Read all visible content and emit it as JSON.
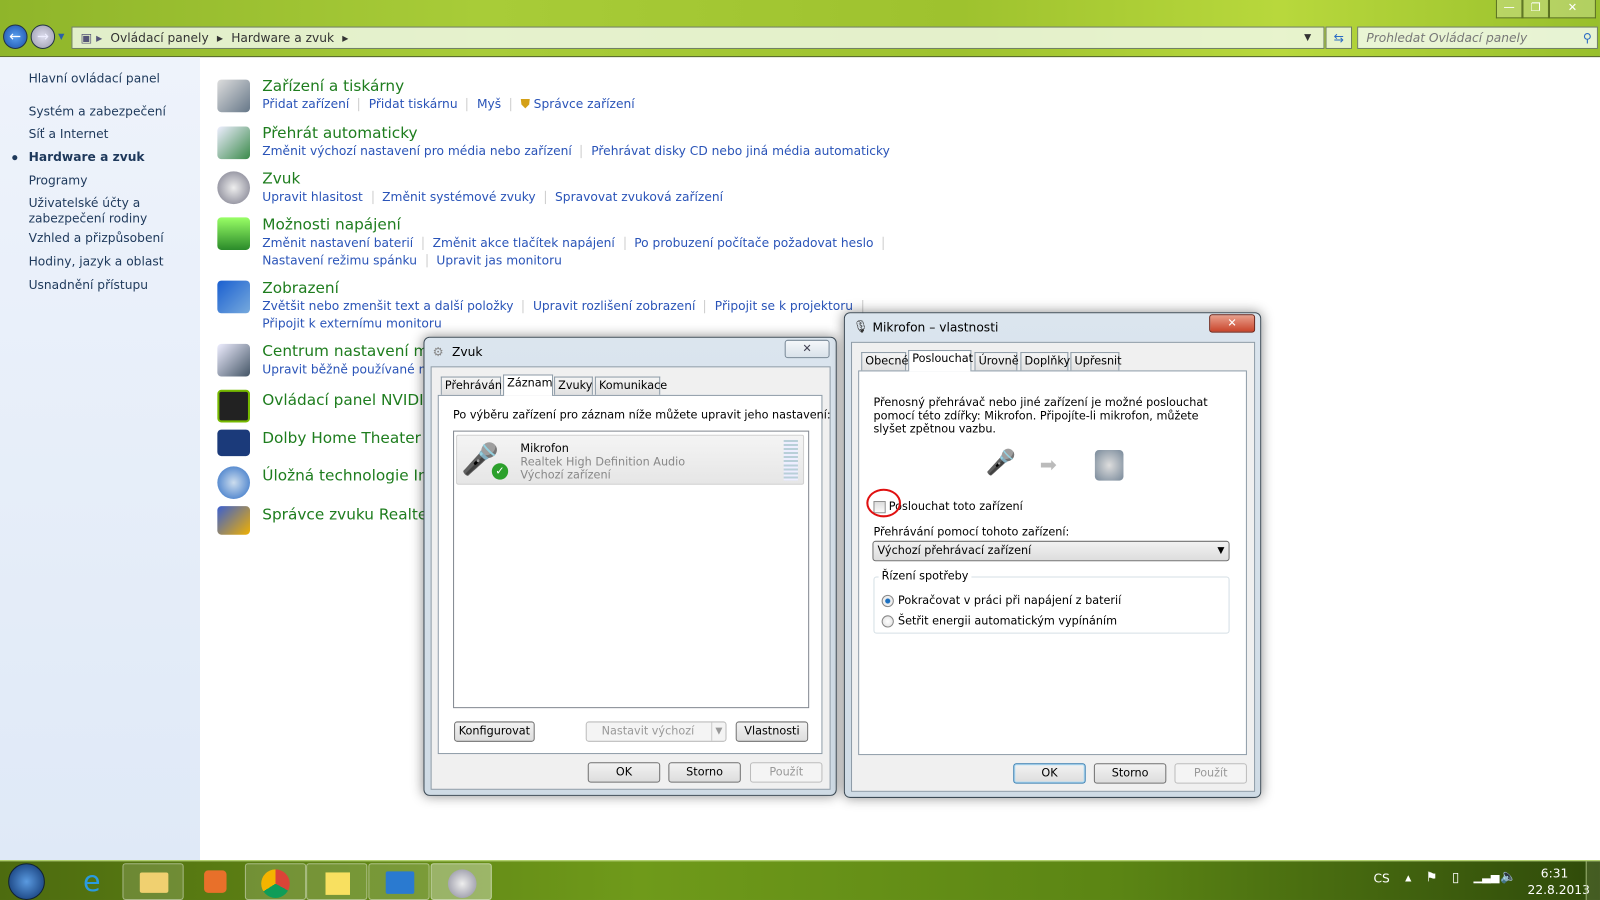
{
  "window": {
    "minimize": "—",
    "restore": "❐",
    "close": "✕"
  },
  "address": {
    "breadcrumb": [
      "Ovládací panely",
      "Hardware a zvuk"
    ],
    "search_placeholder": "Prohledat Ovládací panely"
  },
  "sidebar": {
    "items": [
      {
        "label": "Hlavní ovládací panel"
      },
      {
        "label": "Systém a zabezpečení"
      },
      {
        "label": "Síť a Internet"
      },
      {
        "label": "Hardware a zvuk",
        "active": true
      },
      {
        "label": "Programy"
      },
      {
        "label": "Uživatelské účty a zabezpečení rodiny"
      },
      {
        "label": "Vzhled a přizpůsobení"
      },
      {
        "label": "Hodiny, jazyk a oblast"
      },
      {
        "label": "Usnadnění přístupu"
      }
    ]
  },
  "categories": [
    {
      "title": "Zařízení a tiskárny",
      "icon": "printer-camera-icon",
      "links": [
        "Přidat zařízení",
        "Přidat tiskárnu",
        "Myš",
        "Správce zařízení"
      ]
    },
    {
      "title": "Přehrát automaticky",
      "icon": "autoplay-icon",
      "links": [
        "Změnit výchozí nastavení pro média nebo zařízení",
        "Přehrávat disky CD nebo jiná média automaticky"
      ]
    },
    {
      "title": "Zvuk",
      "icon": "speaker-icon",
      "links": [
        "Upravit hlasitost",
        "Změnit systémové zvuky",
        "Spravovat zvuková zařízení"
      ]
    },
    {
      "title": "Možnosti napájení",
      "icon": "battery-icon",
      "links": [
        "Změnit nastavení baterií",
        "Změnit akce tlačítek napájení",
        "Po probuzení počítače požadovat heslo",
        "Nastavení režimu spánku",
        "Upravit jas monitoru"
      ]
    },
    {
      "title": "Zobrazení",
      "icon": "monitor-icon",
      "links": [
        "Zvětšit nebo zmenšit text a další položky",
        "Upravit rozlišení zobrazení",
        "Připojit se k projektoru",
        "Připojit k externímu monitoru"
      ]
    },
    {
      "title": "Centrum nastavení mo",
      "icon": "mobility-center-icon",
      "links": [
        "Upravit běžně používané možn"
      ]
    },
    {
      "title": "Ovládací panel NVIDIA",
      "icon": "nvidia-icon",
      "links": []
    },
    {
      "title": "Dolby Home Theater",
      "icon": "dolby-icon",
      "links": []
    },
    {
      "title": "Úložná technologie Inte",
      "icon": "intel-storage-icon",
      "links": []
    },
    {
      "title": "Správce zvuku Realtek",
      "icon": "realtek-icon",
      "links": []
    }
  ],
  "sound_dialog": {
    "title": "Zvuk",
    "tabs": [
      "Přehrávání",
      "Záznam",
      "Zvuky",
      "Komunikace"
    ],
    "active_tab": "Záznam",
    "instruction": "Po výběru zařízení pro záznam níže můžete upravit jeho nastavení:",
    "device": {
      "name": "Mikrofon",
      "driver": "Realtek High Definition Audio",
      "status": "Výchozí zařízení"
    },
    "configure": "Konfigurovat",
    "set_default": "Nastavit výchozí",
    "properties": "Vlastnosti",
    "ok": "OK",
    "cancel": "Storno",
    "apply": "Použít"
  },
  "mic_dialog": {
    "title": "Mikrofon – vlastnosti",
    "tabs": [
      "Obecné",
      "Poslouchat",
      "Úrovně",
      "Doplňky",
      "Upřesnit"
    ],
    "active_tab": "Poslouchat",
    "description": "Přenosný přehrávač nebo jiné zařízení je možné poslouchat pomocí této zdířky: Mikrofon. Připojíte-li mikrofon, můžete slyšet zpětnou vazbu.",
    "listen_checkbox": "Poslouchat toto zařízení",
    "listen_checked": false,
    "playback_label": "Přehrávání pomocí tohoto zařízení:",
    "playback_value": "Výchozí přehrávací zařízení",
    "power_group": "Řízení spotřeby",
    "power_options": [
      "Pokračovat v práci při napájení z baterií",
      "Šetřit energii automatickým vypínáním"
    ],
    "power_selected": 0,
    "ok": "OK",
    "cancel": "Storno",
    "apply": "Použít",
    "annotation_color": "#e01010"
  },
  "taskbar": {
    "apps": [
      "start-orb",
      "internet-explorer",
      "windows-explorer",
      "media-player",
      "chrome",
      "sticky-notes",
      "control-panel",
      "sound"
    ],
    "language": "CS",
    "time": "6:31",
    "date": "22.8.2013"
  }
}
